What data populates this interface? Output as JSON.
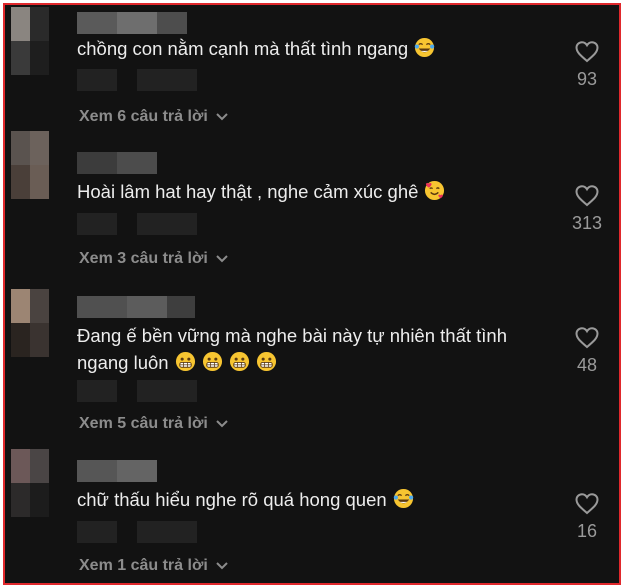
{
  "comments": [
    {
      "text": "chồng con nằm cạnh mà thất tình ngang",
      "emojis": [
        "laugh-cry"
      ],
      "likes": "93",
      "replies_label": "Xem 6 câu trả lời",
      "avatar_colors": [
        "#8a8580",
        "#2a2a2a",
        "#3a3a3a",
        "#1e1e1e"
      ],
      "username_colors": [
        "#5a5a5a",
        "#6e6e6e",
        "#4d4d4d"
      ]
    },
    {
      "text": "Hoài lâm hat hay thật , nghe cảm xúc ghê",
      "emojis": [
        "smiling-hearts"
      ],
      "likes": "313",
      "replies_label": "Xem 3 câu trả lời",
      "avatar_colors": [
        "#5a534f",
        "#6c625c",
        "#4a3f39",
        "#6a5d55"
      ],
      "username_colors": [
        "#3c3c3c",
        "#4c4c4c",
        "#1e2018"
      ]
    },
    {
      "text": "Đang ế bền vững mà nghe bài này tự nhiên thất tình\nngang luôn",
      "emojis": [
        "grimace",
        "grimace",
        "grimace",
        "grimace"
      ],
      "likes": "48",
      "replies_label": "Xem 5 câu trả lời",
      "avatar_colors": [
        "#9c8573",
        "#4a4340",
        "#2a2420",
        "#3a3330"
      ],
      "username_colors": [
        "#505050",
        "#5c5c5c",
        "#3e3e3e"
      ]
    },
    {
      "text": "chữ thấu hiểu nghe rõ quá hong quen",
      "emojis": [
        "laugh-cry"
      ],
      "likes": "16",
      "replies_label": "Xem 1 câu trả lời",
      "avatar_colors": [
        "#6c5858",
        "#4a4545",
        "#2c2a2a",
        "#1c1c1c"
      ],
      "username_colors": [
        "#565656",
        "#646464",
        "#484848"
      ]
    }
  ],
  "accent_color": "#e0282c"
}
